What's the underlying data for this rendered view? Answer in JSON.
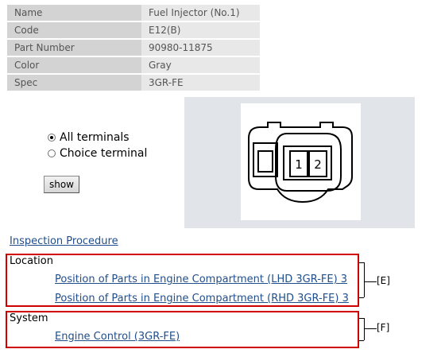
{
  "part_info": [
    {
      "label": "Name",
      "value": "Fuel Injector (No.1)"
    },
    {
      "label": "Code",
      "value": "E12(B)"
    },
    {
      "label": "Part Number",
      "value": "90980-11875"
    },
    {
      "label": "Color",
      "value": "Gray"
    },
    {
      "label": "Spec",
      "value": "3GR-FE"
    }
  ],
  "terminal_options": {
    "all": "All terminals",
    "choice": "Choice terminal",
    "selected": "all"
  },
  "show_label": "show",
  "connector": {
    "pins": [
      "1",
      "2"
    ]
  },
  "inspection_link": "Inspection Procedure",
  "location": {
    "title": "Location",
    "links": [
      "Position of Parts in Engine Compartment (LHD 3GR-FE) 3",
      "Position of Parts in Engine Compartment (RHD 3GR-FE) 3"
    ],
    "tag": "[E]"
  },
  "system": {
    "title": "System",
    "links": [
      "Engine Control (3GR-FE)"
    ],
    "tag": "[F]"
  },
  "colors": {
    "link": "#1f4e8c",
    "box_border": "#d00000",
    "key_bg": "#d3d3d3",
    "value_bg": "#e8e8e8",
    "panel_bg": "#e1e5ea"
  }
}
